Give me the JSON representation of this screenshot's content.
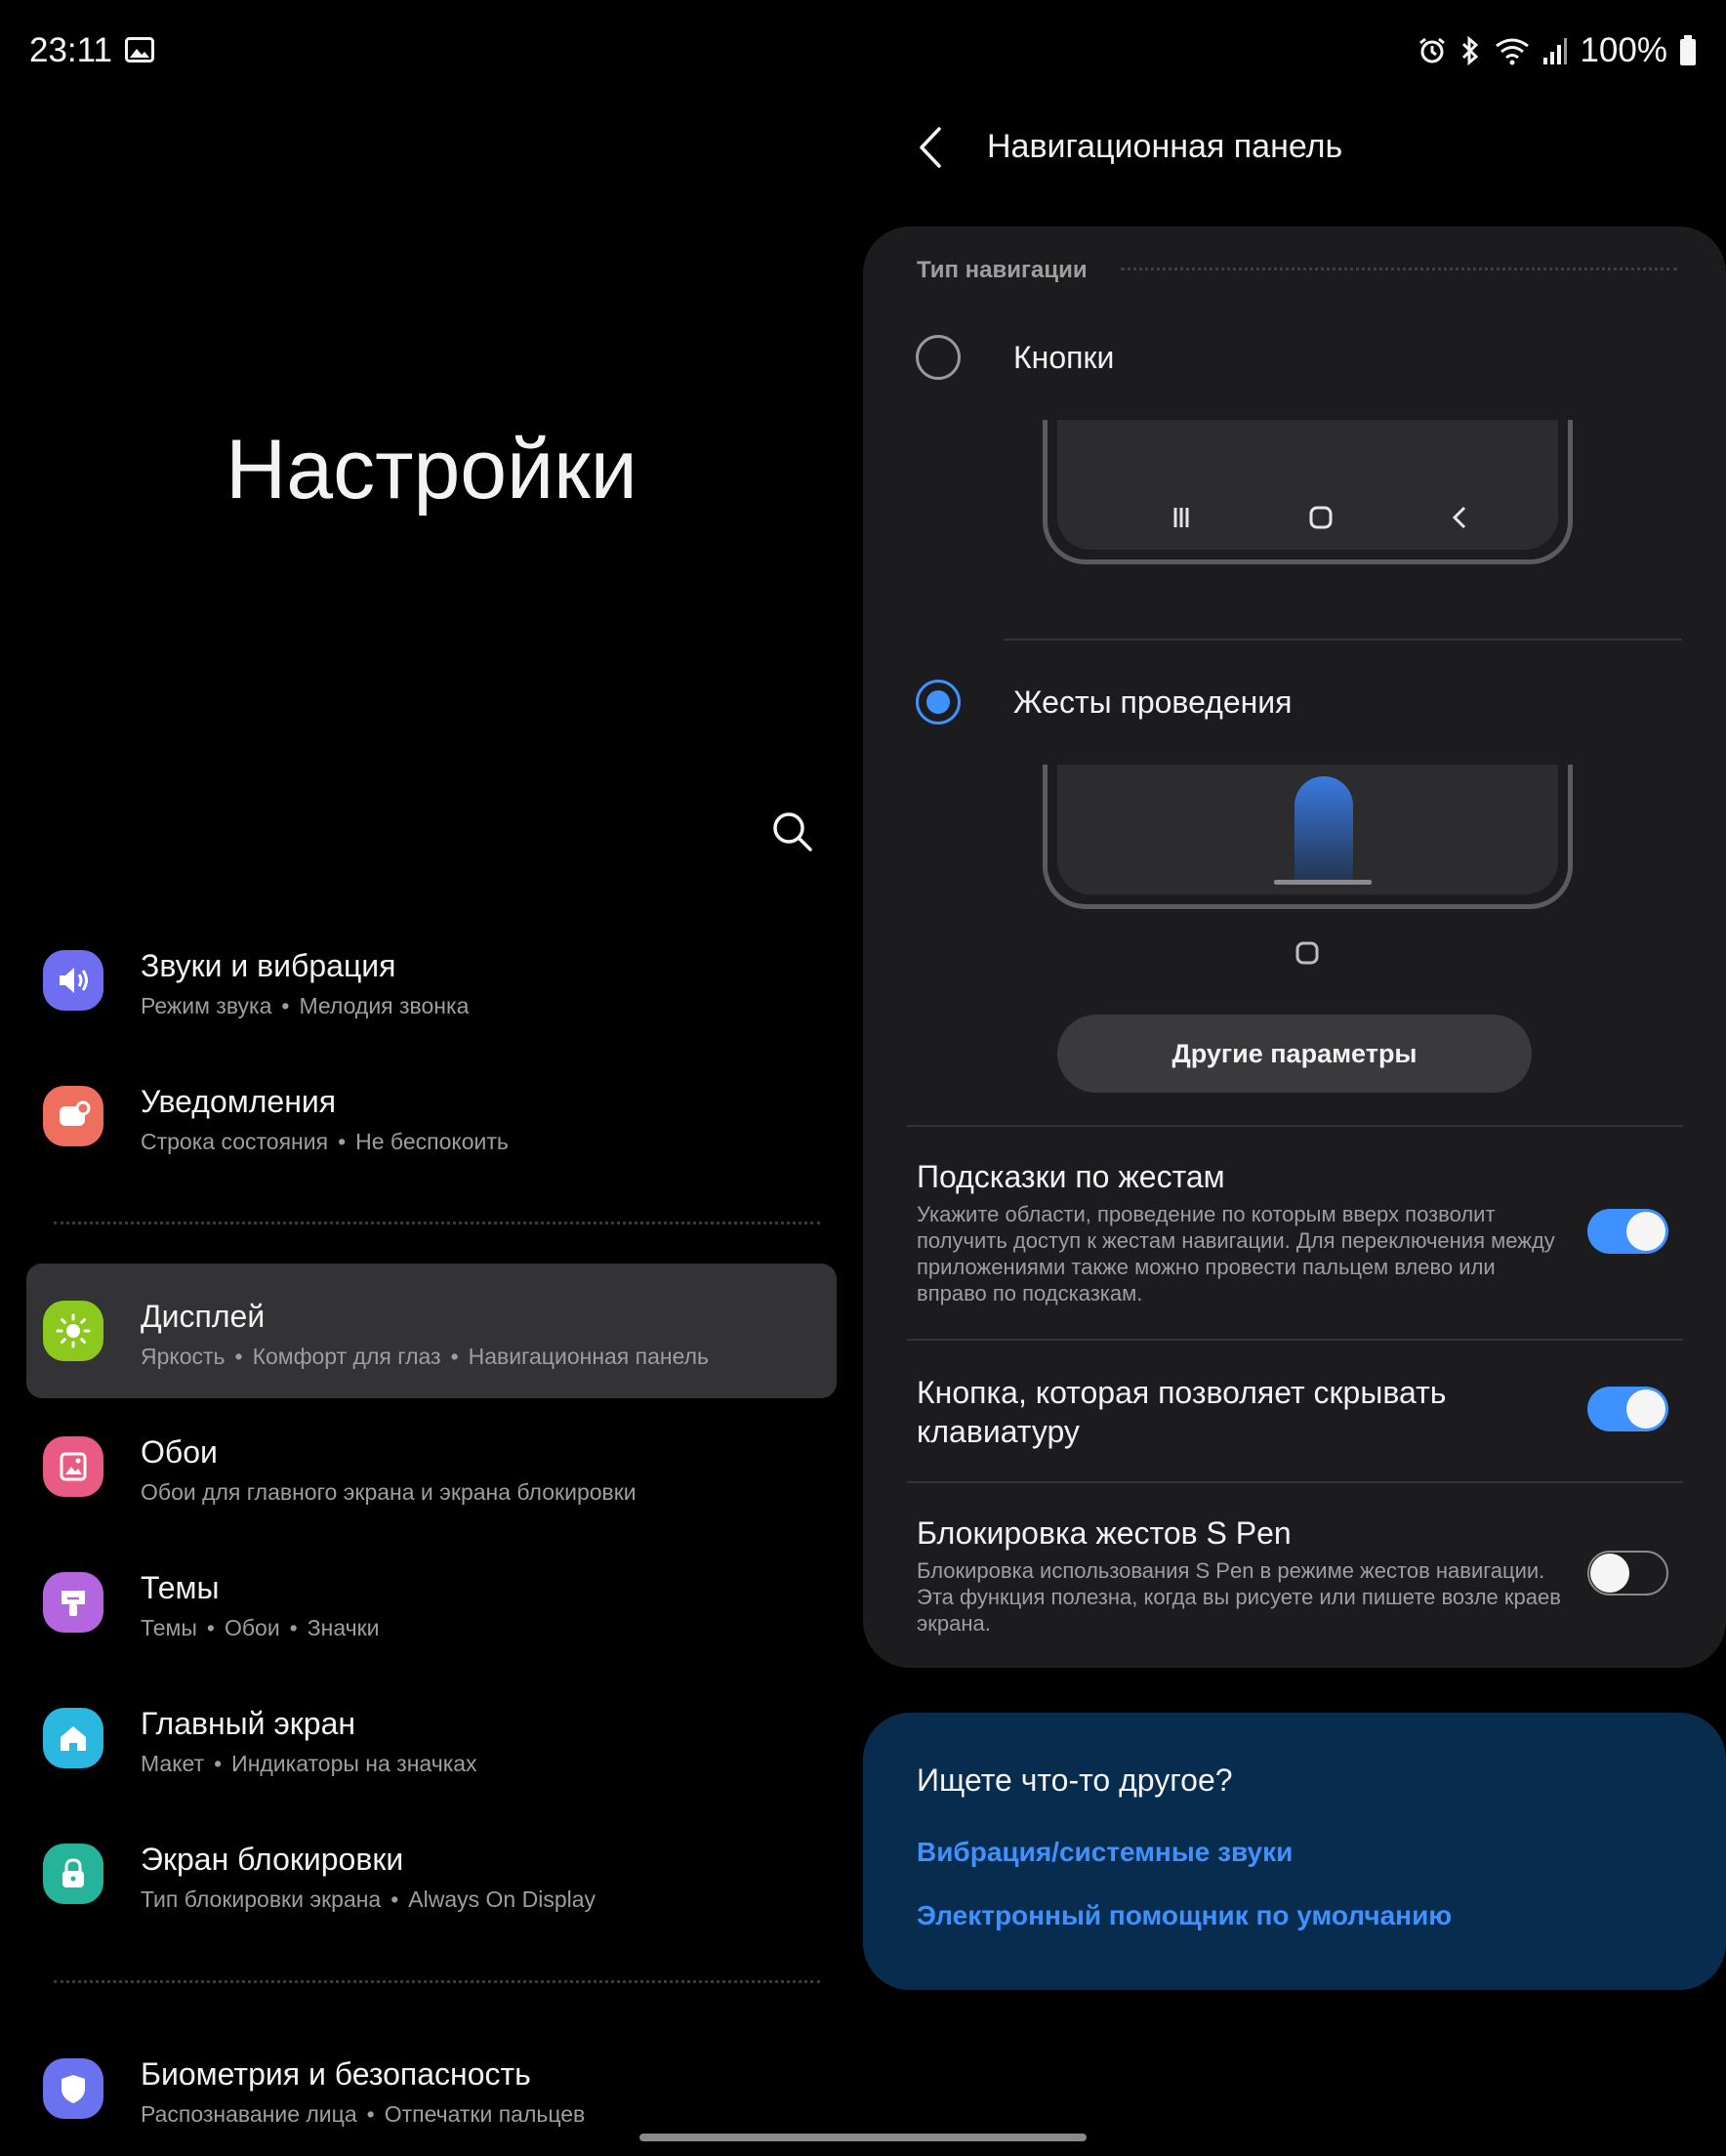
{
  "status_bar": {
    "time": "23:11",
    "battery": "100%",
    "icons": [
      "gallery-icon",
      "alarm-icon",
      "bluetooth-icon",
      "wifi-icon",
      "signal-icon",
      "battery-icon"
    ]
  },
  "settings": {
    "title": "Настройки",
    "search_icon": "search-icon",
    "items": [
      {
        "title": "Звуки и вибрация",
        "subtitles": [
          "Режим звука",
          "Мелодия звонка"
        ],
        "icon": "volume-icon",
        "color": "#6f6df0"
      },
      {
        "title": "Уведомления",
        "subtitles": [
          "Строка состояния",
          "Не беспокоить"
        ],
        "icon": "notification-icon",
        "color": "#ef6f5f"
      },
      {
        "title": "Дисплей",
        "subtitles": [
          "Яркость",
          "Комфорт для глаз",
          "Навигационная панель"
        ],
        "icon": "brightness-icon",
        "color": "#8cc81e"
      },
      {
        "title": "Обои",
        "subtitles": [
          "Обои для главного экрана и экрана блокировки"
        ],
        "icon": "wallpaper-icon",
        "color": "#e95b85"
      },
      {
        "title": "Темы",
        "subtitles": [
          "Темы",
          "Обои",
          "Значки"
        ],
        "icon": "themes-icon",
        "color": "#b466e0"
      },
      {
        "title": "Главный экран",
        "subtitles": [
          "Макет",
          "Индикаторы на значках"
        ],
        "icon": "home-icon",
        "color": "#2ab8e0"
      },
      {
        "title": "Экран блокировки",
        "subtitles": [
          "Тип блокировки экрана",
          "Always On Display"
        ],
        "icon": "lock-icon",
        "color": "#25b39a"
      },
      {
        "title": "Биометрия и безопасность",
        "subtitles": [
          "Распознавание лица",
          "Отпечатки пальцев"
        ],
        "icon": "shield-icon",
        "color": "#6b72f0"
      }
    ]
  },
  "nav_panel": {
    "title": "Навигационная панель",
    "section_label": "Тип навигации",
    "options": [
      {
        "label": "Кнопки",
        "selected": false
      },
      {
        "label": "Жесты проведения",
        "selected": true
      }
    ],
    "more_button": "Другие параметры",
    "toggles": [
      {
        "title": "Подсказки по жестам",
        "desc": "Укажите области, проведение по которым вверх позволит получить доступ к жестам навигации. Для переключения между приложениями также можно провести пальцем влево или вправо по подсказкам.",
        "on": true
      },
      {
        "title": "Кнопка, которая позволяет скрывать клавиатуру",
        "desc": "",
        "on": true
      },
      {
        "title": "Блокировка жестов S Pen",
        "desc": "Блокировка использования S Pen в режиме жестов навигации. Эта функция полезна, когда вы рисуете или пишете возле краев экрана.",
        "on": false
      }
    ]
  },
  "suggest": {
    "title": "Ищете что-то другое?",
    "links": [
      "Вибрация/системные звуки",
      "Электронный помощник по умолчанию"
    ]
  },
  "colors": {
    "accent": "#3e91ff",
    "active_item_bg": "#333335",
    "card_bg": "#1c1c1e",
    "suggest_bg": "#072c4e"
  }
}
